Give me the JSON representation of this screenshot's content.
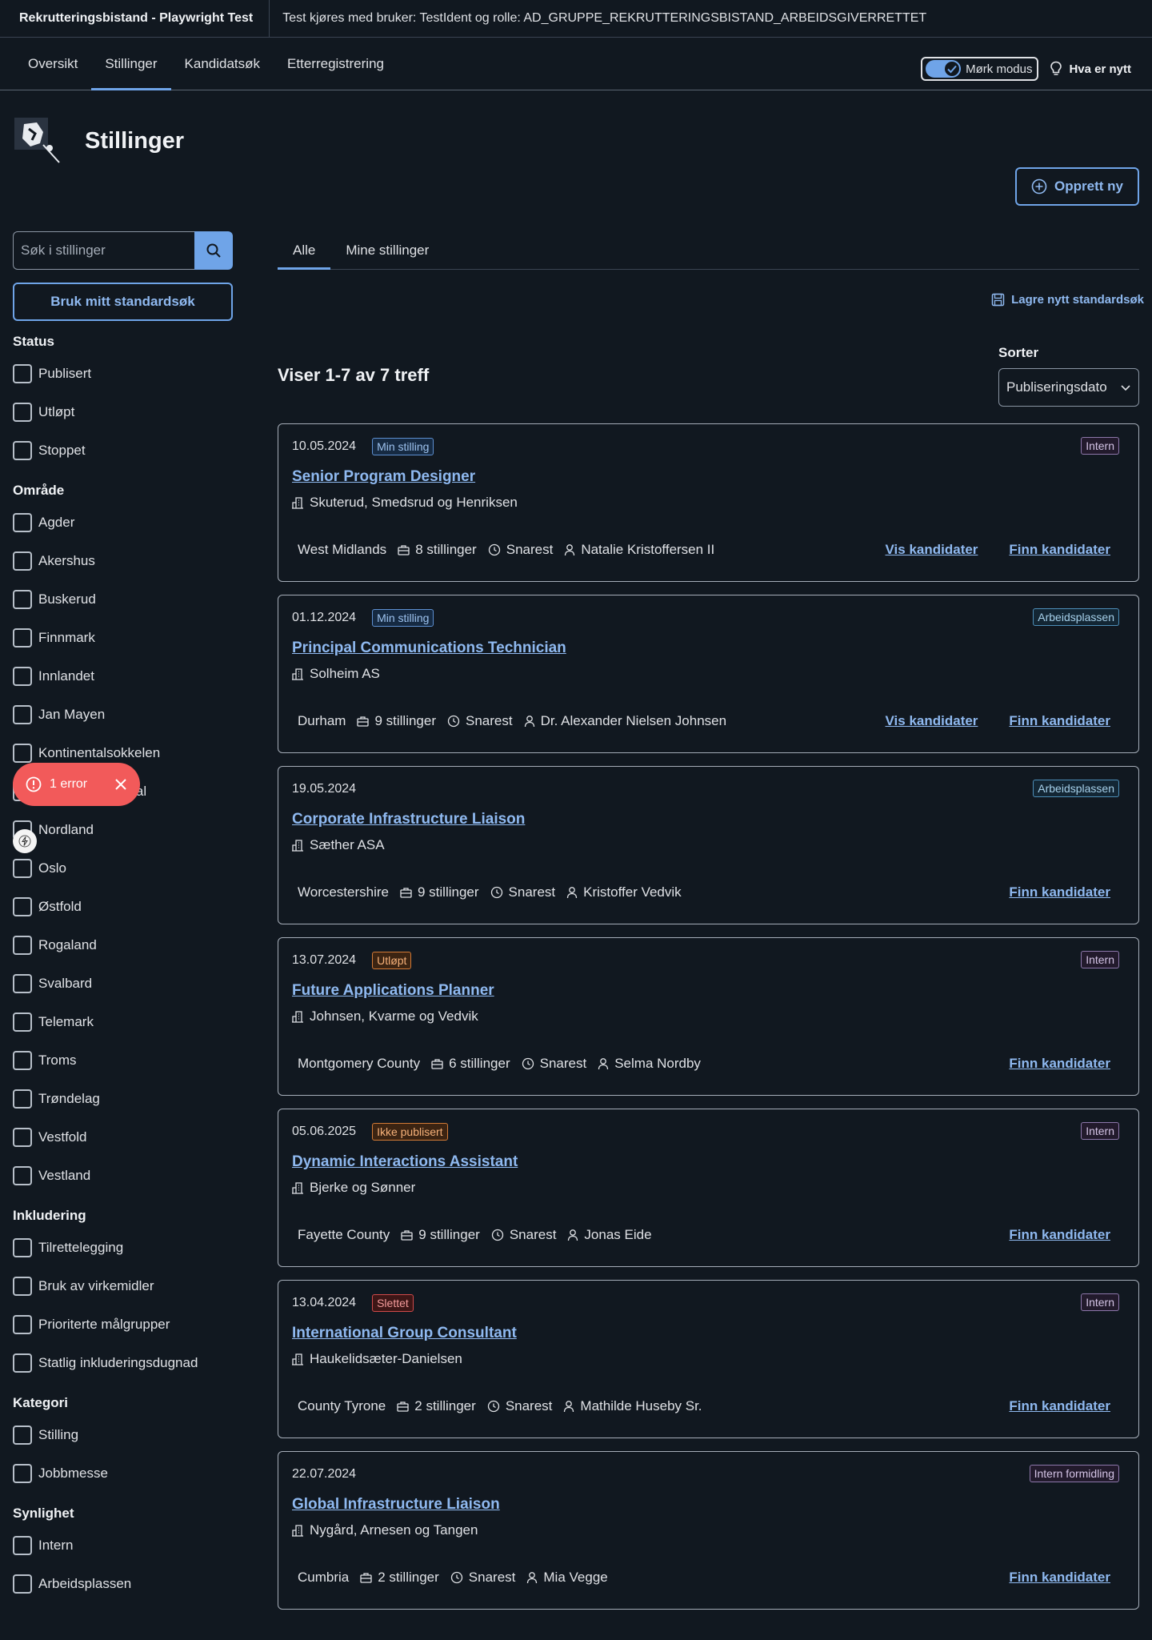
{
  "header": {
    "app_name": "Rekrutteringsbistand - Playwright Test",
    "test_info": "Test kjøres med bruker: TestIdent og rolle: AD_GRUPPE_REKRUTTERINGSBISTAND_ARBEIDSGIVERRETTET"
  },
  "nav": {
    "tabs": [
      {
        "label": "Oversikt"
      },
      {
        "label": "Stillinger"
      },
      {
        "label": "Kandidatsøk"
      },
      {
        "label": "Etterregistrering"
      }
    ],
    "active_tab": "Stillinger",
    "dark_mode_label": "Mørk modus",
    "dark_mode_on": true,
    "news_label": "Hva er nytt"
  },
  "page": {
    "title": "Stillinger",
    "create_button": "Opprett ny"
  },
  "sidebar": {
    "search_placeholder": "Søk i stillinger",
    "standard_search_button": "Bruk mitt standardsøk",
    "groups": [
      {
        "title": "Status",
        "items": [
          "Publisert",
          "Utløpt",
          "Stoppet"
        ]
      },
      {
        "title": "Område",
        "items": [
          "Agder",
          "Akershus",
          "Buskerud",
          "Finnmark",
          "Innlandet",
          "Jan Mayen",
          "Kontinentalsokkelen",
          "Møre og Romsdal",
          "Nordland",
          "Oslo",
          "Østfold",
          "Rogaland",
          "Svalbard",
          "Telemark",
          "Troms",
          "Trøndelag",
          "Vestfold",
          "Vestland"
        ]
      },
      {
        "title": "Inkludering",
        "items": [
          "Tilrettelegging",
          "Bruk av virkemidler",
          "Prioriterte målgrupper",
          "Statlig inkluderingsdugnad"
        ]
      },
      {
        "title": "Kategori",
        "items": [
          "Stilling",
          "Jobbmesse"
        ]
      },
      {
        "title": "Synlighet",
        "items": [
          "Intern",
          "Arbeidsplassen"
        ]
      }
    ]
  },
  "error_toast": {
    "label": "1 error"
  },
  "main": {
    "tabs": [
      {
        "label": "Alle"
      },
      {
        "label": "Mine stillinger"
      }
    ],
    "save_search": "Lagre nytt standardsøk",
    "result_count": "Viser 1-7 av 7 treff",
    "sort_label": "Sorter",
    "sort_value": "Publiseringsdato"
  },
  "cards": [
    {
      "date": "10.05.2024",
      "status_tag": "Min stilling",
      "status_color": "blue",
      "visibility_tag": "Intern",
      "visibility_color": "purple",
      "title": "Senior Program Designer",
      "employer": "Skuterud, Smedsrud og Henriksen",
      "location": "West Midlands",
      "positions": "8 stillinger",
      "deadline": "Snarest",
      "contact": "Natalie Kristoffersen II",
      "show_vis": true,
      "vis_label": "Vis kandidater",
      "finn_label": "Finn kandidater"
    },
    {
      "date": "01.12.2024",
      "status_tag": "Min stilling",
      "status_color": "blue",
      "visibility_tag": "Arbeidsplassen",
      "visibility_color": "teal",
      "title": "Principal Communications Technician",
      "employer": "Solheim AS",
      "location": "Durham",
      "positions": "9 stillinger",
      "deadline": "Snarest",
      "contact": "Dr. Alexander Nielsen Johnsen",
      "show_vis": true,
      "vis_label": "Vis kandidater",
      "finn_label": "Finn kandidater"
    },
    {
      "date": "19.05.2024",
      "status_tag": "",
      "status_color": "",
      "visibility_tag": "Arbeidsplassen",
      "visibility_color": "teal",
      "title": "Corporate Infrastructure Liaison",
      "employer": "Sæther ASA",
      "location": "Worcestershire",
      "positions": "9 stillinger",
      "deadline": "Snarest",
      "contact": "Kristoffer Vedvik",
      "show_vis": false,
      "vis_label": "",
      "finn_label": "Finn kandidater"
    },
    {
      "date": "13.07.2024",
      "status_tag": "Utløpt",
      "status_color": "orange",
      "visibility_tag": "Intern",
      "visibility_color": "purple",
      "title": "Future Applications Planner",
      "employer": "Johnsen, Kvarme og Vedvik",
      "location": "Montgomery County",
      "positions": "6 stillinger",
      "deadline": "Snarest",
      "contact": "Selma Nordby",
      "show_vis": false,
      "vis_label": "",
      "finn_label": "Finn kandidater"
    },
    {
      "date": "05.06.2025",
      "status_tag": "Ikke publisert",
      "status_color": "orange",
      "visibility_tag": "Intern",
      "visibility_color": "purple",
      "title": "Dynamic Interactions Assistant",
      "employer": "Bjerke og Sønner",
      "location": "Fayette County",
      "positions": "9 stillinger",
      "deadline": "Snarest",
      "contact": "Jonas Eide",
      "show_vis": false,
      "vis_label": "",
      "finn_label": "Finn kandidater"
    },
    {
      "date": "13.04.2024",
      "status_tag": "Slettet",
      "status_color": "red",
      "visibility_tag": "Intern",
      "visibility_color": "purple",
      "title": "International Group Consultant",
      "employer": "Haukelidsæter-Danielsen",
      "location": "County Tyrone",
      "positions": "2 stillinger",
      "deadline": "Snarest",
      "contact": "Mathilde Huseby Sr.",
      "show_vis": false,
      "vis_label": "",
      "finn_label": "Finn kandidater"
    },
    {
      "date": "22.07.2024",
      "status_tag": "",
      "status_color": "",
      "visibility_tag": "Intern formidling",
      "visibility_color": "purple",
      "title": "Global Infrastructure Liaison",
      "employer": "Nygård, Arnesen og Tangen",
      "location": "Cumbria",
      "positions": "2 stillinger",
      "deadline": "Snarest",
      "contact": "Mia Vegge",
      "show_vis": false,
      "vis_label": "",
      "finn_label": "Finn kandidater"
    }
  ],
  "colors": {
    "accent": "#6fa4e8",
    "background": "#111820",
    "error": "#f25a5a"
  }
}
